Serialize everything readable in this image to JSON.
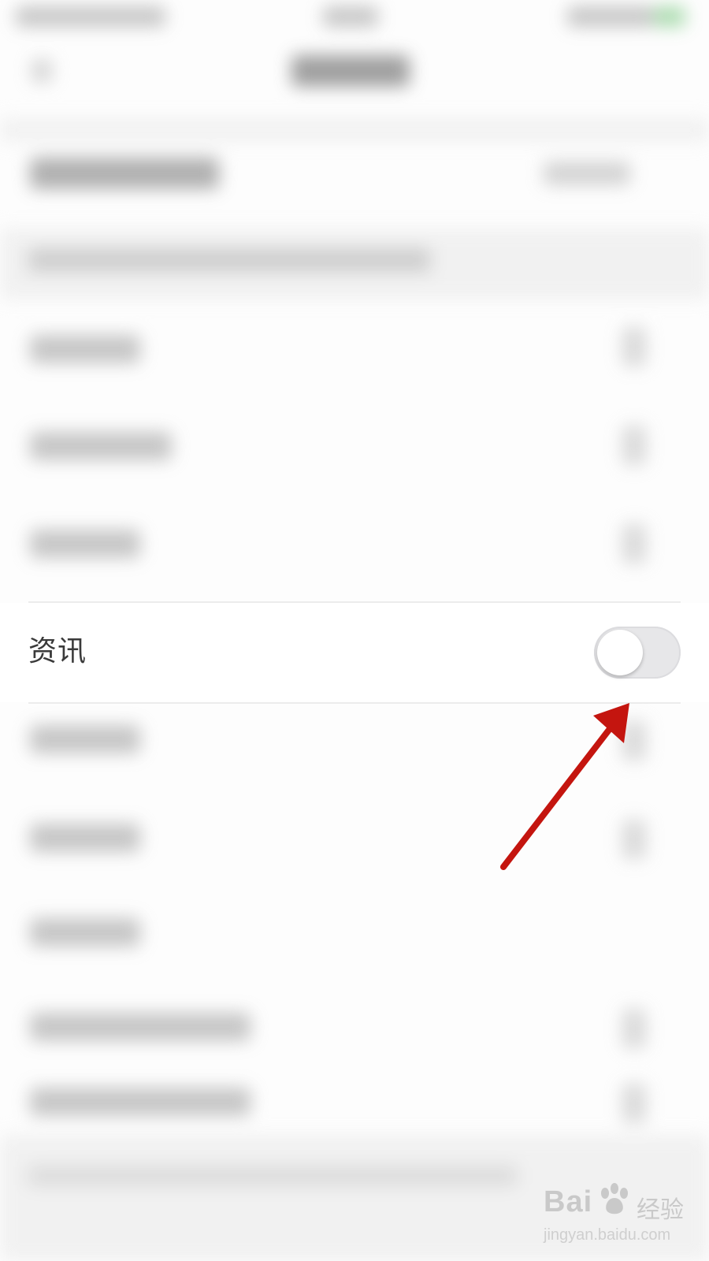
{
  "focused_row": {
    "label": "资讯",
    "toggle_on": false
  },
  "colors": {
    "annotation_arrow": "#c4150f",
    "toggle_off_track": "#e7e7e9",
    "label_text": "#3a3a3a"
  },
  "watermark": {
    "brand": "Bai",
    "brand_suffix": "经验",
    "url": "jingyan.baidu.com"
  },
  "icons": {
    "watermark_paw": "baidu-paw-icon"
  }
}
